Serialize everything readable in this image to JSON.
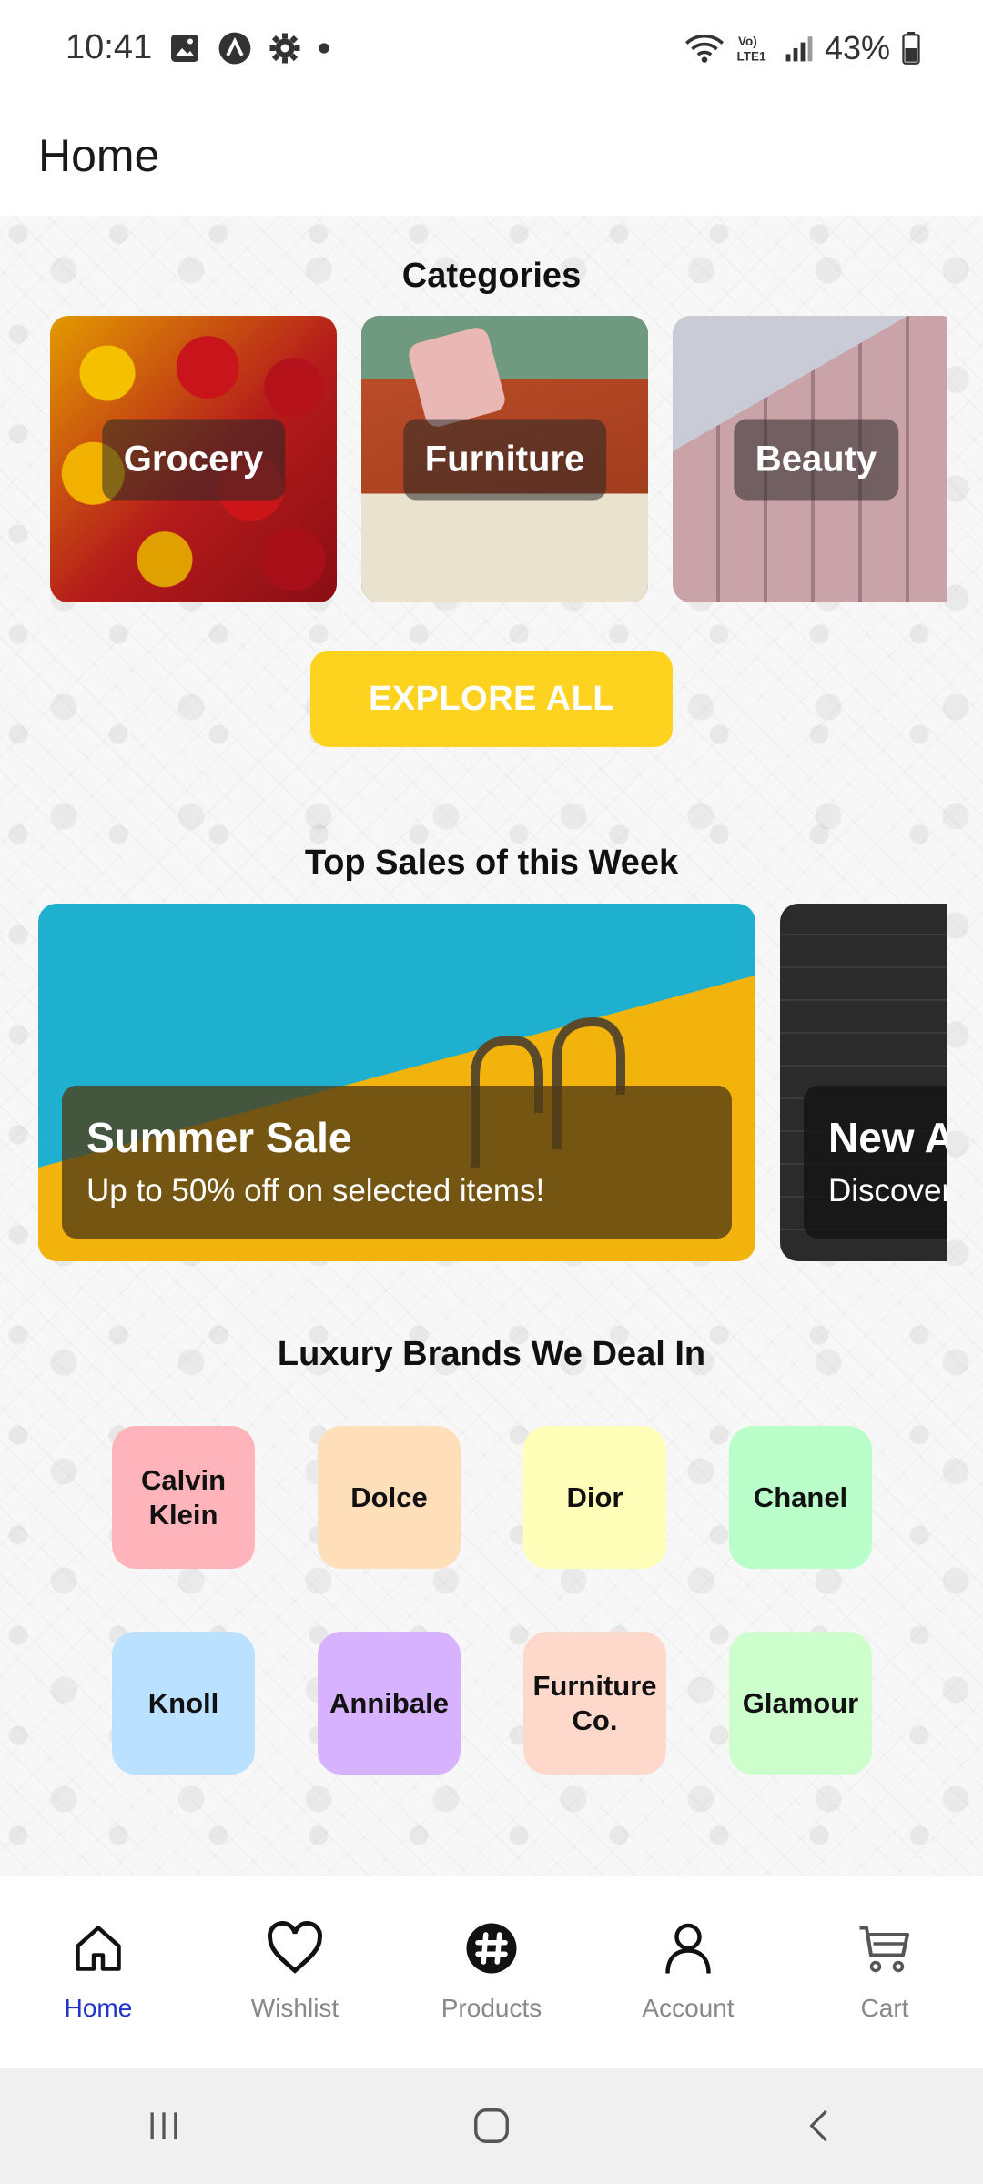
{
  "status_bar": {
    "time": "10:41",
    "battery": "43%",
    "icons": [
      "image-icon",
      "app-a-icon",
      "settings-icon",
      "dot-icon",
      "wifi-icon",
      "volte-icon",
      "signal-icon",
      "battery-icon"
    ],
    "volte_text": "Vo) LTE1"
  },
  "app_bar": {
    "title": "Home"
  },
  "categories": {
    "title": "Categories",
    "items": [
      {
        "label": "Grocery"
      },
      {
        "label": "Furniture"
      },
      {
        "label": "Beauty"
      }
    ],
    "explore_label": "EXPLORE ALL",
    "explore_color": "#fdd31f"
  },
  "top_sales": {
    "title": "Top Sales of this Week",
    "items": [
      {
        "title": "Summer Sale",
        "subtitle": "Up to 50% off on selected items!"
      },
      {
        "title": "New Arrivals",
        "subtitle": "Discover"
      }
    ]
  },
  "brands": {
    "title": "Luxury Brands We Deal In",
    "items": [
      {
        "name": "Calvin Klein",
        "color": "#ffb3ba"
      },
      {
        "name": "Dolce",
        "color": "#ffdfba"
      },
      {
        "name": "Dior",
        "color": "#ffffba"
      },
      {
        "name": "Chanel",
        "color": "#baffc9"
      },
      {
        "name": "Knoll",
        "color": "#bae1ff"
      },
      {
        "name": "Annibale",
        "color": "#d7b3ff"
      },
      {
        "name": "Furniture Co.",
        "color": "#ffd8cc"
      },
      {
        "name": "Glamour",
        "color": "#ccffcc"
      }
    ]
  },
  "bottom_nav": {
    "active_color": "#2233cc",
    "items": [
      {
        "label": "Home",
        "icon": "home-icon",
        "active": true
      },
      {
        "label": "Wishlist",
        "icon": "heart-icon",
        "active": false
      },
      {
        "label": "Products",
        "icon": "hashtag-icon",
        "active": false
      },
      {
        "label": "Account",
        "icon": "user-icon",
        "active": false
      },
      {
        "label": "Cart",
        "icon": "cart-icon",
        "active": false
      }
    ]
  },
  "system_nav": {
    "icons": [
      "recents-icon",
      "home-button-icon",
      "back-icon"
    ]
  }
}
